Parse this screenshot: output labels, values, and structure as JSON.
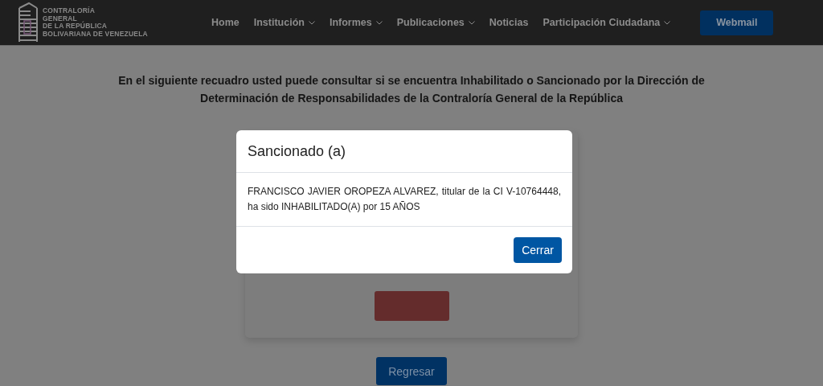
{
  "header": {
    "logo_lines": [
      "CONTRALORÍA",
      "GENERAL",
      "DE LA REPÚBLICA",
      "BOLIVARIANA DE VENEZUELA"
    ],
    "nav": [
      {
        "label": "Home",
        "dropdown": false
      },
      {
        "label": "Institución",
        "dropdown": true
      },
      {
        "label": "Informes",
        "dropdown": true
      },
      {
        "label": "Publicaciones",
        "dropdown": true
      },
      {
        "label": "Noticias",
        "dropdown": false
      },
      {
        "label": "Participación Ciudadana",
        "dropdown": true
      }
    ],
    "webmail_button": "Webmail"
  },
  "intro": "En el siguiente recuadro usted puede consultar si se encuentra Inhabilitado o Sancionado por la Dirección de Determinación de Responsabilidades de la Contraloría General de la República",
  "back_button": "Regresar",
  "modal": {
    "title": "Sancionado (a)",
    "message": "FRANCISCO JAVIER OROPEZA ALVAREZ, titular de la CI V-10764448, ha sido INHABILITADO(A) por 15 AÑOS",
    "close_button": "Cerrar"
  }
}
